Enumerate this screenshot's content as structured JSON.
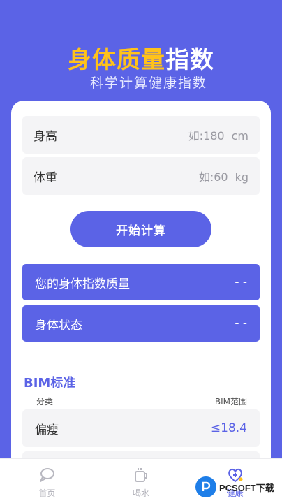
{
  "header": {
    "title_highlight": "身体质量",
    "title_rest": "指数",
    "subtitle": "科学计算健康指数"
  },
  "form": {
    "height_label": "身高",
    "height_placeholder": "如:180",
    "height_unit": "cm",
    "weight_label": "体重",
    "weight_placeholder": "如:60",
    "weight_unit": "kg",
    "calc_button": "开始计算"
  },
  "results": [
    {
      "label": "您的身体指数质量",
      "value": "- -"
    },
    {
      "label": "身体状态",
      "value": "- -"
    }
  ],
  "standard": {
    "title": "BIM标准",
    "col_category": "分类",
    "col_range": "BIM范围",
    "rows": [
      {
        "name": "偏瘦",
        "range": "≤18.4"
      }
    ]
  },
  "tabbar": [
    {
      "label": "首页",
      "icon": "home-icon"
    },
    {
      "label": "喝水",
      "icon": "cup-icon"
    },
    {
      "label": "健康",
      "icon": "health-heart-icon"
    }
  ],
  "watermark": {
    "text": "PCSOFT下载"
  },
  "colors": {
    "primary": "#5b63e6",
    "accent": "#ffc21a"
  }
}
